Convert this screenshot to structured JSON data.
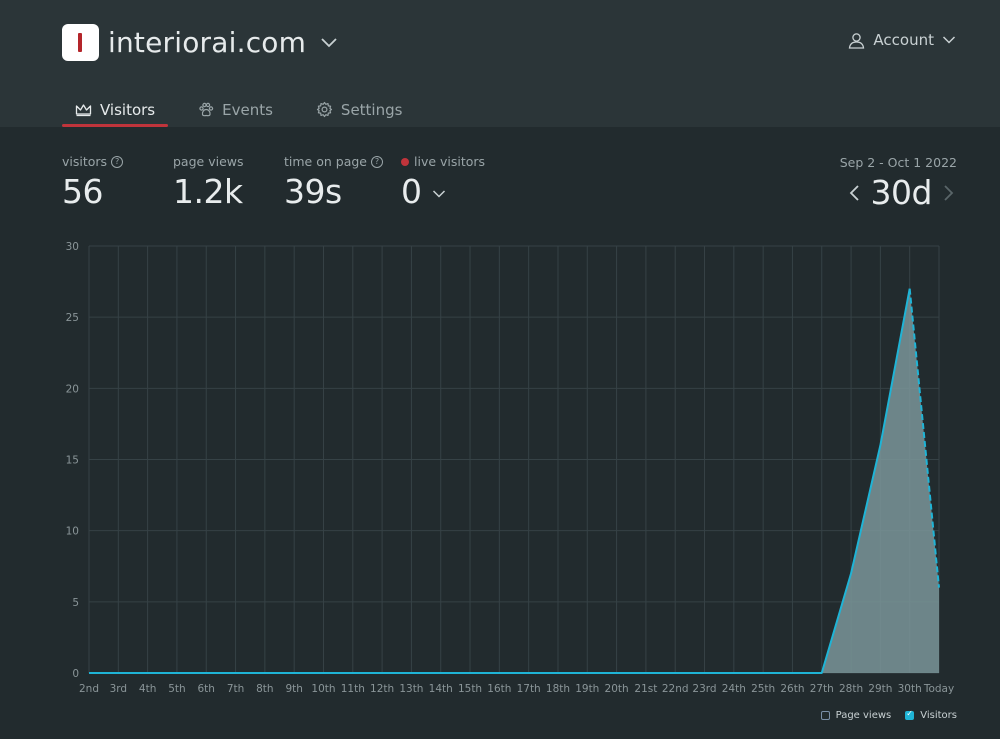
{
  "header": {
    "site_name": "interiorai.com",
    "account_label": "Account"
  },
  "tabs": [
    {
      "label": "Visitors",
      "icon": "crown-icon",
      "active": true
    },
    {
      "label": "Events",
      "icon": "paw-icon",
      "active": false
    },
    {
      "label": "Settings",
      "icon": "gear-icon",
      "active": false
    }
  ],
  "stats": {
    "visitors": {
      "label": "visitors",
      "value": "56"
    },
    "page_views": {
      "label": "page views",
      "value": "1.2k"
    },
    "time_on_page": {
      "label": "time on page",
      "value": "39s"
    },
    "live_visitors": {
      "label": "live visitors",
      "value": "0"
    }
  },
  "range": {
    "dates": "Sep 2 - Oct 1 2022",
    "value": "30d"
  },
  "legend": {
    "page_views": "Page views",
    "visitors": "Visitors"
  },
  "colors": {
    "accent": "#c0343b",
    "series": "#1fb4d6",
    "area": "#7a9599"
  },
  "chart_data": {
    "type": "area",
    "categories": [
      "2nd",
      "3rd",
      "4th",
      "5th",
      "6th",
      "7th",
      "8th",
      "9th",
      "10th",
      "11th",
      "12th",
      "13th",
      "14th",
      "15th",
      "16th",
      "17th",
      "18th",
      "19th",
      "20th",
      "21st",
      "22nd",
      "23rd",
      "24th",
      "25th",
      "26th",
      "27th",
      "28th",
      "29th",
      "30th",
      "Today"
    ],
    "series": [
      {
        "name": "Visitors",
        "values": [
          0,
          0,
          0,
          0,
          0,
          0,
          0,
          0,
          0,
          0,
          0,
          0,
          0,
          0,
          0,
          0,
          0,
          0,
          0,
          0,
          0,
          0,
          0,
          0,
          0,
          0,
          7,
          16,
          27,
          6
        ]
      }
    ],
    "y_ticks": [
      0,
      5,
      10,
      15,
      20,
      25,
      30
    ],
    "ylim": [
      0,
      30
    ],
    "grid": true,
    "last_segment_dashed": true
  }
}
